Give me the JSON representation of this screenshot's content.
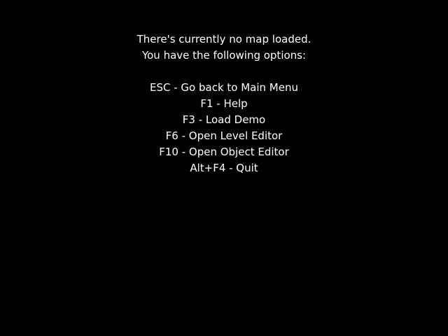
{
  "screen": {
    "background_color": "#000000",
    "text_color": "#ffffff"
  },
  "message": {
    "line1": "There's currently no map loaded.",
    "line2": "You have the following options:"
  },
  "options": [
    {
      "key": "ESC",
      "action": "Go back to Main Menu",
      "text": "ESC - Go back to Main Menu"
    },
    {
      "key": "F1",
      "action": "Help",
      "text": "F1 - Help"
    },
    {
      "key": "F3",
      "action": "Load Demo",
      "text": "F3 - Load Demo"
    },
    {
      "key": "F6",
      "action": "Open Level Editor",
      "text": "F6 - Open Level Editor"
    },
    {
      "key": "F10",
      "action": "Open Object Editor",
      "text": "F10 - Open Object Editor"
    },
    {
      "key": "Alt+F4",
      "action": "Quit",
      "text": "Alt+F4 - Quit"
    }
  ]
}
